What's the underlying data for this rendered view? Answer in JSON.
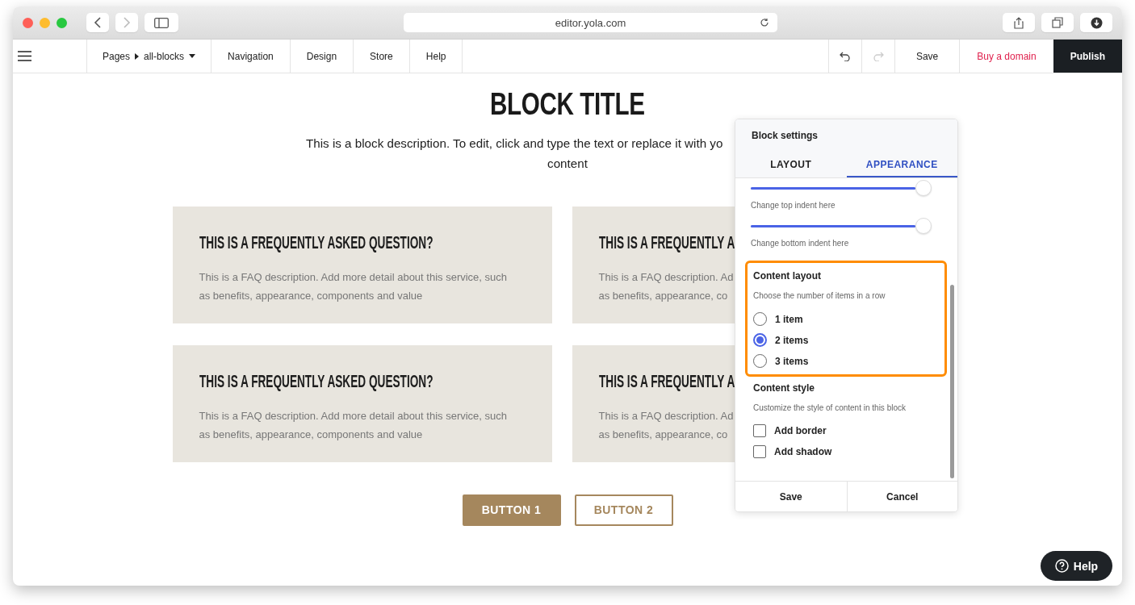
{
  "browser": {
    "url": "editor.yola.com"
  },
  "app_bar": {
    "pages_label": "Pages",
    "page": "all-blocks",
    "nav": [
      "Navigation",
      "Design",
      "Store",
      "Help"
    ],
    "undo": {
      "disabled": false
    },
    "redo": {
      "disabled": true
    },
    "save": "Save",
    "buy_domain": "Buy a domain",
    "publish": "Publish"
  },
  "page": {
    "title": "BLOCK TITLE",
    "description_lines": [
      "This is a block description. To edit, click and type the text or replace it with yo",
      "content"
    ],
    "faqs": [
      {
        "question": "THIS IS A FREQUENTLY ASKED QUESTION?",
        "description_lines": [
          "This is a FAQ description. Add more detail about this service, such",
          "as benefits, appearance, components and value"
        ]
      },
      {
        "question": "THIS IS A FREQUENTLY A",
        "description_lines": [
          "This is a FAQ description. Ad",
          "as benefits, appearance, co"
        ]
      },
      {
        "question": "THIS IS A FREQUENTLY ASKED QUESTION?",
        "description_lines": [
          "This is a FAQ description. Add more detail about this service, such",
          "as benefits, appearance, components and value"
        ]
      },
      {
        "question": "THIS IS A FREQUENTLY A",
        "description_lines": [
          "This is a FAQ description. Ad",
          "as benefits, appearance, co"
        ]
      }
    ],
    "buttons": [
      {
        "label": "BUTTON 1",
        "kind": "filled"
      },
      {
        "label": "BUTTON 2",
        "kind": "outline"
      }
    ]
  },
  "panel": {
    "title": "Block settings",
    "tabs": [
      {
        "label": "LAYOUT",
        "selected": false
      },
      {
        "label": "APPEARANCE",
        "selected": true
      }
    ],
    "sliders": [
      {
        "level": 1,
        "caption": "Change top indent here"
      },
      {
        "level": 1,
        "caption": "Change bottom indent here"
      }
    ],
    "content_layout": {
      "title": "Content layout",
      "hint": "Choose the number of items in a row",
      "highlighted": true,
      "options": [
        {
          "label": "1 item",
          "selected": false
        },
        {
          "label": "2 items",
          "selected": true
        },
        {
          "label": "3 items",
          "selected": false
        }
      ]
    },
    "content_style": {
      "title": "Content style",
      "hint": "Customize the style of content in this block",
      "options": [
        {
          "label": "Add border",
          "checked": false
        },
        {
          "label": "Add shadow",
          "checked": false
        }
      ]
    },
    "buttons": [
      "Save",
      "Cancel"
    ]
  },
  "help_button": {
    "label": "Help"
  }
}
